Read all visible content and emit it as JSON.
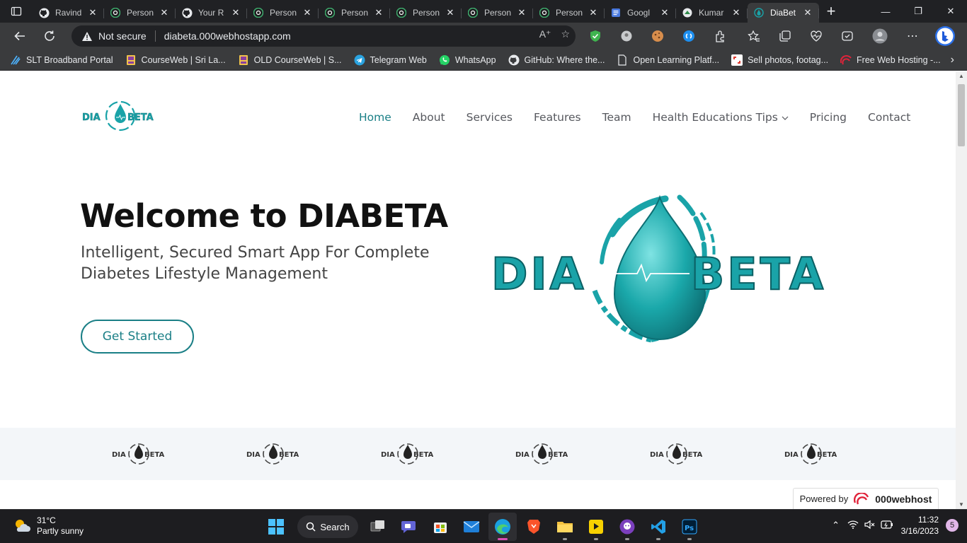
{
  "tabs": [
    {
      "title": "Ravind",
      "icon": "github-icon"
    },
    {
      "title": "Person",
      "icon": "chatgpt-icon"
    },
    {
      "title": "Your R",
      "icon": "github-icon"
    },
    {
      "title": "Person",
      "icon": "chatgpt-icon"
    },
    {
      "title": "Person",
      "icon": "chatgpt-icon"
    },
    {
      "title": "Person",
      "icon": "chatgpt-icon"
    },
    {
      "title": "Person",
      "icon": "chatgpt-icon"
    },
    {
      "title": "Person",
      "icon": "chatgpt-icon"
    },
    {
      "title": "Googl",
      "icon": "google-icon"
    },
    {
      "title": "Kumar",
      "icon": "site-icon"
    },
    {
      "title": "DiaBet",
      "icon": "diabeta-icon",
      "active": true
    }
  ],
  "address": {
    "security_label": "Not secure",
    "url": "diabeta.000webhostapp.com"
  },
  "bookmarks": [
    {
      "label": "SLT Broadband Portal",
      "icon": "slt-icon"
    },
    {
      "label": "CourseWeb | Sri La...",
      "icon": "courseweb-icon"
    },
    {
      "label": "OLD CourseWeb | S...",
      "icon": "courseweb-icon"
    },
    {
      "label": "Telegram Web",
      "icon": "telegram-icon"
    },
    {
      "label": "WhatsApp",
      "icon": "whatsapp-icon"
    },
    {
      "label": "GitHub: Where the...",
      "icon": "github-icon"
    },
    {
      "label": "Open Learning Platf...",
      "icon": "page-icon"
    },
    {
      "label": "Sell photos, footag...",
      "icon": "shutterstock-icon"
    },
    {
      "label": "Free Web Hosting -...",
      "icon": "000webhost-icon"
    }
  ],
  "site": {
    "nav": [
      "Home",
      "About",
      "Services",
      "Features",
      "Team",
      "Health Educations Tips",
      "Pricing",
      "Contact"
    ],
    "active_nav": "Home",
    "hero_title": "Welcome to DIABETA",
    "hero_subtitle": "Intelligent, Secured Smart App For Complete Diabetes Lifestyle Management",
    "cta_label": "Get Started",
    "logo_left": "DIA",
    "logo_right": "BETA",
    "powered_prefix": "Powered by",
    "powered_brand": "000webhost"
  },
  "colors": {
    "brand_teal": "#1a7f86",
    "logo_teal": "#1aa3a8"
  },
  "taskbar": {
    "temperature": "31°C",
    "weather": "Partly sunny",
    "search_label": "Search",
    "time": "11:32",
    "date": "3/16/2023",
    "notifications": "5"
  }
}
